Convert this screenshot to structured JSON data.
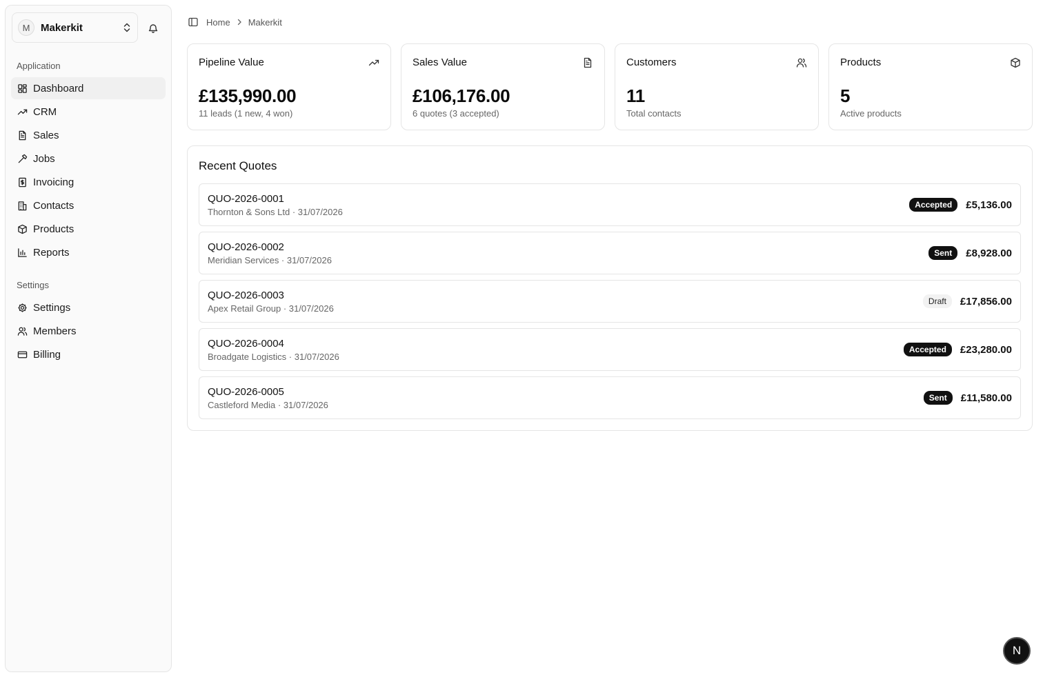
{
  "account": {
    "initial": "M",
    "name": "Makerkit"
  },
  "sidebar": {
    "sections": [
      {
        "label": "Application",
        "items": [
          {
            "label": "Dashboard",
            "icon": "dashboard-icon",
            "active": true
          },
          {
            "label": "CRM",
            "icon": "trending-up-icon"
          },
          {
            "label": "Sales",
            "icon": "document-icon"
          },
          {
            "label": "Jobs",
            "icon": "hammer-icon"
          },
          {
            "label": "Invoicing",
            "icon": "receipt-icon"
          },
          {
            "label": "Contacts",
            "icon": "building-icon"
          },
          {
            "label": "Products",
            "icon": "package-icon"
          },
          {
            "label": "Reports",
            "icon": "bar-chart-icon"
          }
        ]
      },
      {
        "label": "Settings",
        "items": [
          {
            "label": "Settings",
            "icon": "gear-icon"
          },
          {
            "label": "Members",
            "icon": "users-icon"
          },
          {
            "label": "Billing",
            "icon": "credit-card-icon"
          }
        ]
      }
    ]
  },
  "breadcrumb": [
    "Home",
    "Makerkit"
  ],
  "stats": [
    {
      "title": "Pipeline Value",
      "value": "£135,990.00",
      "sub": "11 leads (1 new, 4 won)",
      "icon": "trending-up-icon"
    },
    {
      "title": "Sales Value",
      "value": "£106,176.00",
      "sub": "6 quotes (3 accepted)",
      "icon": "document-icon"
    },
    {
      "title": "Customers",
      "value": "11",
      "sub": "Total contacts",
      "icon": "users-icon"
    },
    {
      "title": "Products",
      "value": "5",
      "sub": "Active products",
      "icon": "package-icon"
    }
  ],
  "recent_quotes": {
    "title": "Recent Quotes",
    "rows": [
      {
        "id": "QUO-2026-0001",
        "meta": "Thornton & Sons Ltd · 31/07/2026",
        "status": "Accepted",
        "amount": "£5,136.00"
      },
      {
        "id": "QUO-2026-0002",
        "meta": "Meridian Services · 31/07/2026",
        "status": "Sent",
        "amount": "£8,928.00"
      },
      {
        "id": "QUO-2026-0003",
        "meta": "Apex Retail Group · 31/07/2026",
        "status": "Draft",
        "amount": "£17,856.00"
      },
      {
        "id": "QUO-2026-0004",
        "meta": "Broadgate Logistics · 31/07/2026",
        "status": "Accepted",
        "amount": "£23,280.00"
      },
      {
        "id": "QUO-2026-0005",
        "meta": "Castleford Media · 31/07/2026",
        "status": "Sent",
        "amount": "£11,580.00"
      }
    ]
  },
  "floating_button": {
    "label": "N"
  },
  "colors": {
    "badge_dark": "#111111",
    "badge_light": "#f2f2f2",
    "border": "#e5e5e5",
    "active_nav": "#f0f0f0"
  }
}
